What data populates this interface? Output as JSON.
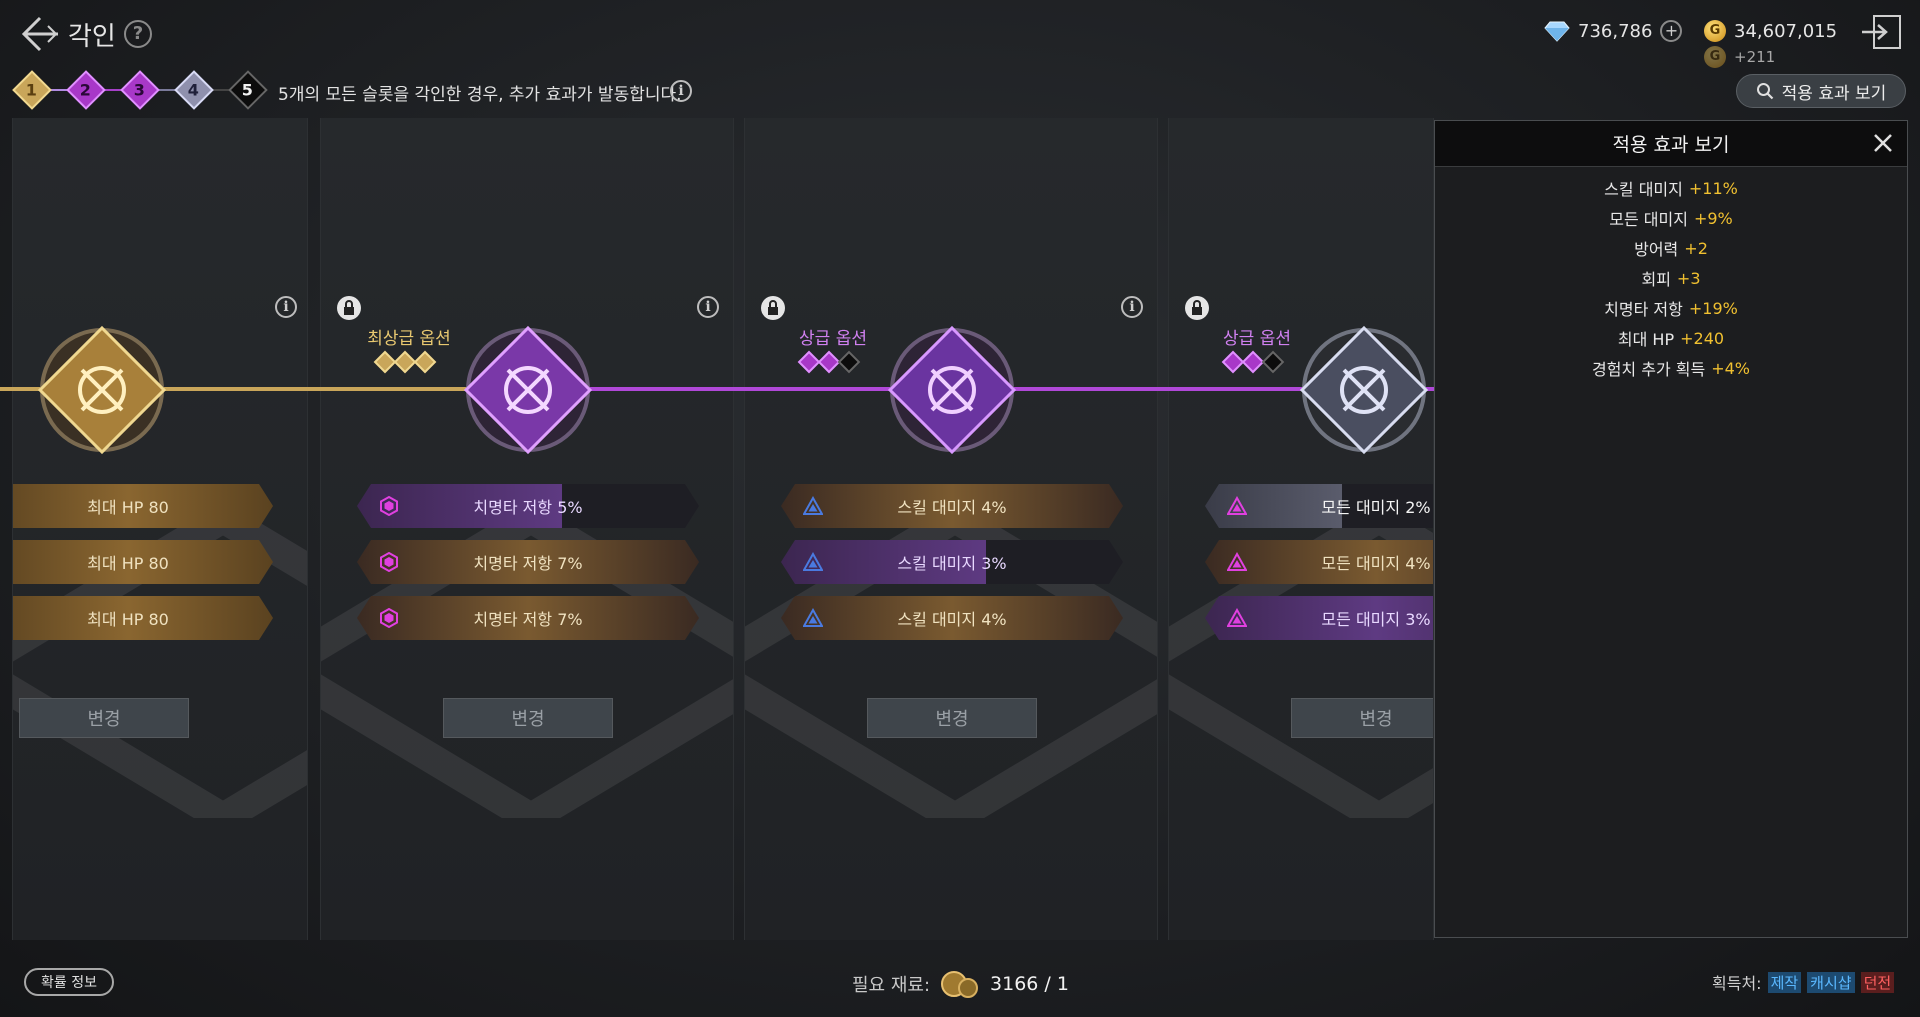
{
  "header": {
    "title": "각인",
    "help": "?"
  },
  "currency": {
    "gems": "736,786",
    "gold": "34,607,015",
    "gold_income": "+211",
    "gold_symbol": "G",
    "plus": "+"
  },
  "steps": [
    "1",
    "2",
    "3",
    "4",
    "5"
  ],
  "notice": "5개의 모든 슬롯을 각인한 경우, 추가 효과가 발동합니다.",
  "effect_button": "적용 효과 보기",
  "columns": [
    {
      "grade": "",
      "slots": [
        "최대 HP 80",
        "최대 HP 80",
        "최대 HP 80"
      ],
      "change": "변경"
    },
    {
      "grade": "최상급 옵션",
      "slots": [
        "치명타 저항 5%",
        "치명타 저항 7%",
        "치명타 저항 7%"
      ],
      "change": "변경"
    },
    {
      "grade": "상급 옵션",
      "slots": [
        "스킬 대미지 4%",
        "스킬 대미지 3%",
        "스킬 대미지 4%"
      ],
      "change": "변경"
    },
    {
      "grade": "상급 옵션",
      "slots": [
        "모든 대미지 2%",
        "모든 대미지 4%",
        "모든 대미지 3%"
      ],
      "change": "변경"
    }
  ],
  "panel": {
    "title": "적용 효과 보기",
    "effects": [
      {
        "name": "스킬 대미지",
        "value": "+11%"
      },
      {
        "name": "모든 대미지",
        "value": "+9%"
      },
      {
        "name": "방어력",
        "value": "+2"
      },
      {
        "name": "회피",
        "value": "+3"
      },
      {
        "name": "치명타 저항",
        "value": "+19%"
      },
      {
        "name": "최대 HP",
        "value": "+240"
      },
      {
        "name": "경험치 추가 획득",
        "value": "+4%"
      }
    ]
  },
  "footer": {
    "prob_info": "확률 정보",
    "required_label": "필요 재료:",
    "required_count": "3166 / 1",
    "source_label": "획득처:",
    "sources": [
      "제작",
      "캐시샵",
      "던전"
    ]
  }
}
